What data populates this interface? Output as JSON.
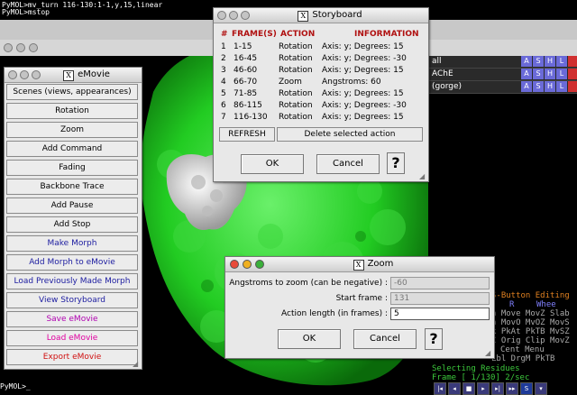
{
  "console": {
    "lines": [
      "PyMOL>mv_turn 116-130:1-1,y,15,linear",
      "PyMOL>mstop"
    ]
  },
  "objects": [
    {
      "name": "all"
    },
    {
      "name": "AChE"
    },
    {
      "name": "(gorge)"
    }
  ],
  "object_buttons": [
    "A",
    "S",
    "H",
    "L",
    ""
  ],
  "mouse": {
    "title": "S-Button Editing",
    "header": [
      "M",
      "R",
      "Whee"
    ],
    "rows": [
      "n Move MovZ Slab",
      "n MovO MvOZ MovS",
      "k PkAt PkTB MvSZ",
      "C Orig Clip MovZ",
      "Cent Menu",
      "Lbl DrgM PkTB"
    ],
    "selecting": "Selecting Residues",
    "frame": "Frame [   1/130] 2/sec"
  },
  "prompt": "PyMOL>_",
  "emovie": {
    "title": "eMovie",
    "buttons": [
      {
        "label": "Scenes (views, appearances)",
        "color": "black"
      },
      {
        "label": "Rotation",
        "color": "black"
      },
      {
        "label": "Zoom",
        "color": "black"
      },
      {
        "label": "Add Command",
        "color": "black"
      },
      {
        "label": "Fading",
        "color": "black"
      },
      {
        "label": "Backbone Trace",
        "color": "black"
      },
      {
        "label": "Add Pause",
        "color": "black"
      },
      {
        "label": "Add Stop",
        "color": "black"
      },
      {
        "label": "Make Morph",
        "color": "blue"
      },
      {
        "label": "Add Morph to eMovie",
        "color": "blue"
      },
      {
        "label": "Load Previously Made Morph",
        "color": "blue"
      },
      {
        "label": "View Storyboard",
        "color": "blue"
      },
      {
        "label": "Save eMovie",
        "color": "magenta"
      },
      {
        "label": "Load eMovie",
        "color": "pink"
      },
      {
        "label": "Export eMovie",
        "color": "red"
      }
    ]
  },
  "storyboard": {
    "title": "Storyboard",
    "headers": {
      "num": "#",
      "frames": "FRAME(S)",
      "action": "ACTION",
      "info": "INFORMATION"
    },
    "rows": [
      {
        "num": "1",
        "frames": "1-15",
        "action": "Rotation",
        "info": "Axis: y; Degrees: 15"
      },
      {
        "num": "2",
        "frames": "16-45",
        "action": "Rotation",
        "info": "Axis: y; Degrees: -30"
      },
      {
        "num": "3",
        "frames": "46-60",
        "action": "Rotation",
        "info": "Axis: y; Degrees: 15"
      },
      {
        "num": "4",
        "frames": "66-70",
        "action": "Zoom",
        "info": "Angstroms: 60"
      },
      {
        "num": "5",
        "frames": "71-85",
        "action": "Rotation",
        "info": "Axis: y; Degrees: 15"
      },
      {
        "num": "6",
        "frames": "86-115",
        "action": "Rotation",
        "info": "Axis: y; Degrees: -30"
      },
      {
        "num": "7",
        "frames": "116-130",
        "action": "Rotation",
        "info": "Axis: y; Degrees: 15"
      }
    ],
    "refresh": "REFRESH",
    "delete": "Delete selected action",
    "ok": "OK",
    "cancel": "Cancel",
    "help": "?"
  },
  "zoom": {
    "title": "Zoom",
    "fields": [
      {
        "label": "Angstroms to zoom (can be negative) :",
        "value": "-60"
      },
      {
        "label": "Start frame :",
        "value": "131"
      },
      {
        "label": "Action length (in frames) :",
        "value": "5"
      }
    ],
    "ok": "OK",
    "cancel": "Cancel",
    "help": "?"
  },
  "colors": {
    "protein": "#22cc22",
    "gorge": "#d8d8d8",
    "zoom_close": "#e84a3a",
    "zoom_min": "#f0b020",
    "zoom_max": "#3ab03a"
  }
}
